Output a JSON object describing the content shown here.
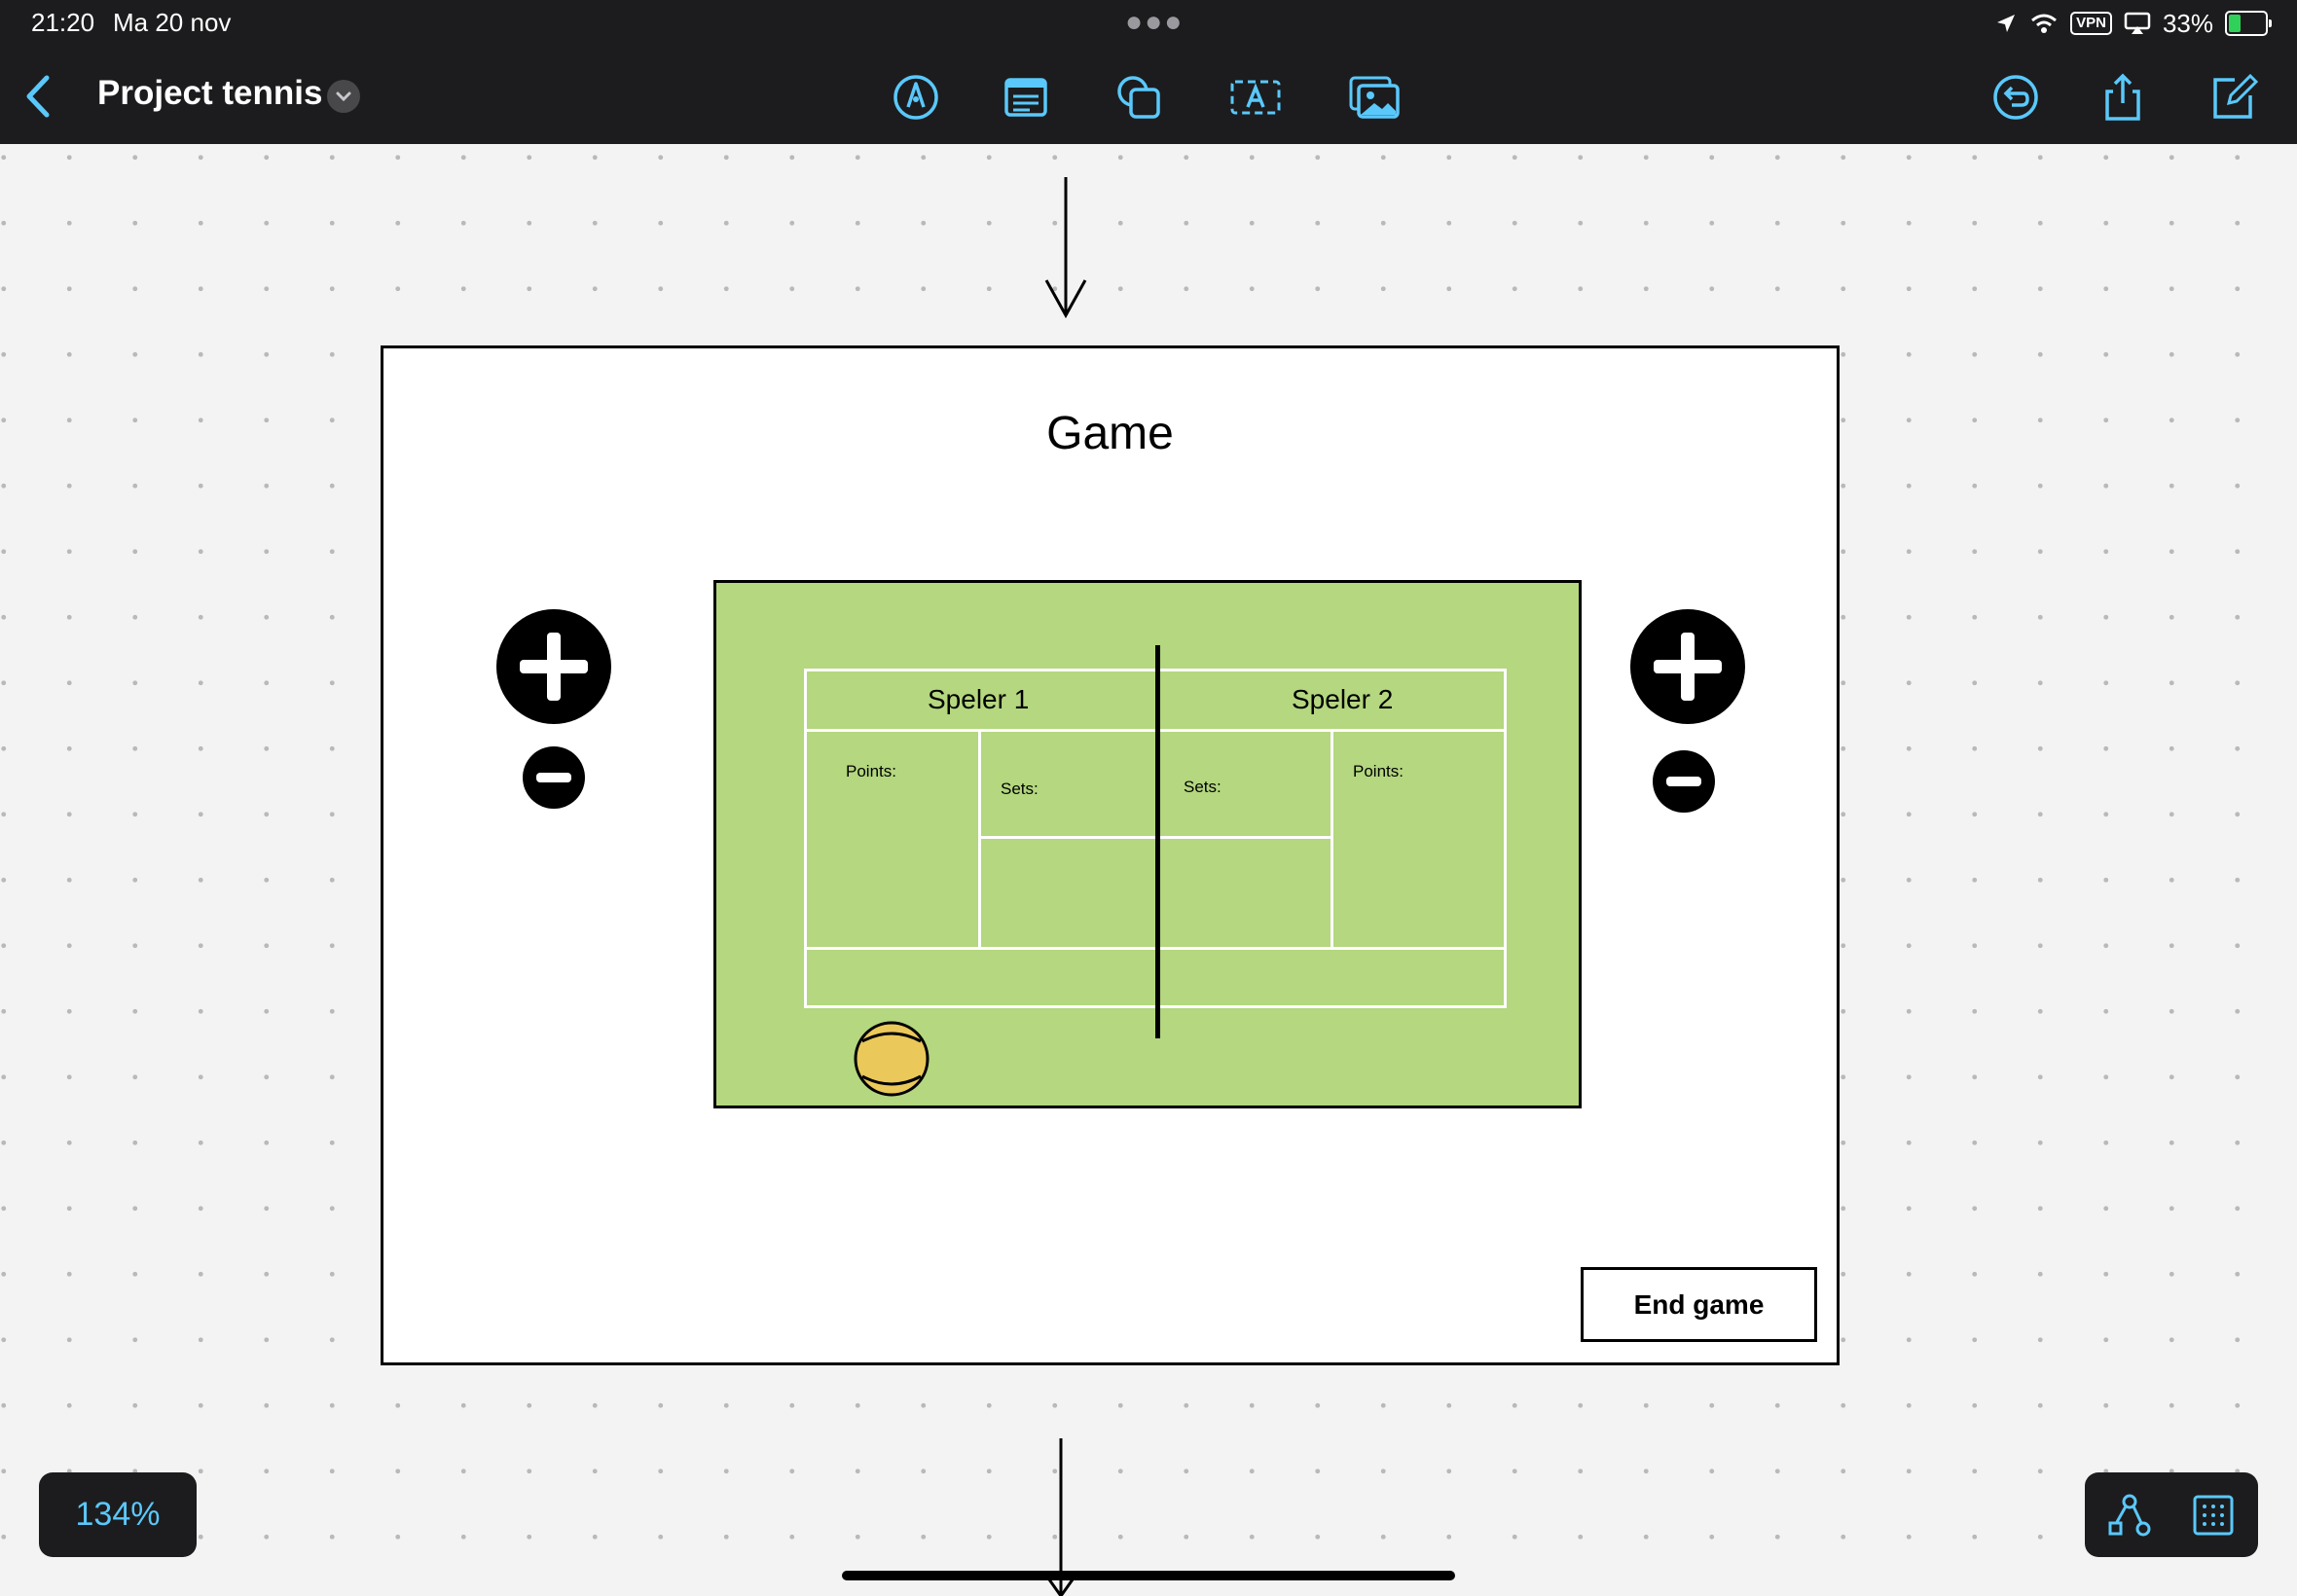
{
  "status_bar": {
    "time": "21:20",
    "date": "Ma 20 nov",
    "vpn": "VPN",
    "battery": "33%"
  },
  "toolbar": {
    "title": "Project tennis",
    "tools": [
      "pen-tool-icon",
      "sticky-note-icon",
      "shapes-icon",
      "text-box-icon",
      "media-icon"
    ],
    "right_actions": [
      "undo-icon",
      "share-icon",
      "compose-icon"
    ],
    "accent_color": "#5ac8fa"
  },
  "frame": {
    "title": "Game",
    "end_button": "End game"
  },
  "court": {
    "player1": "Speler 1",
    "player2": "Speler 2",
    "p1_points_label": "Points:",
    "p1_sets_label": "Sets:",
    "p2_sets_label": "Sets:",
    "p2_points_label": "Points:",
    "court_color": "#b4d77f",
    "ball_color": "#eac85a"
  },
  "zoom": {
    "level": "134%"
  }
}
